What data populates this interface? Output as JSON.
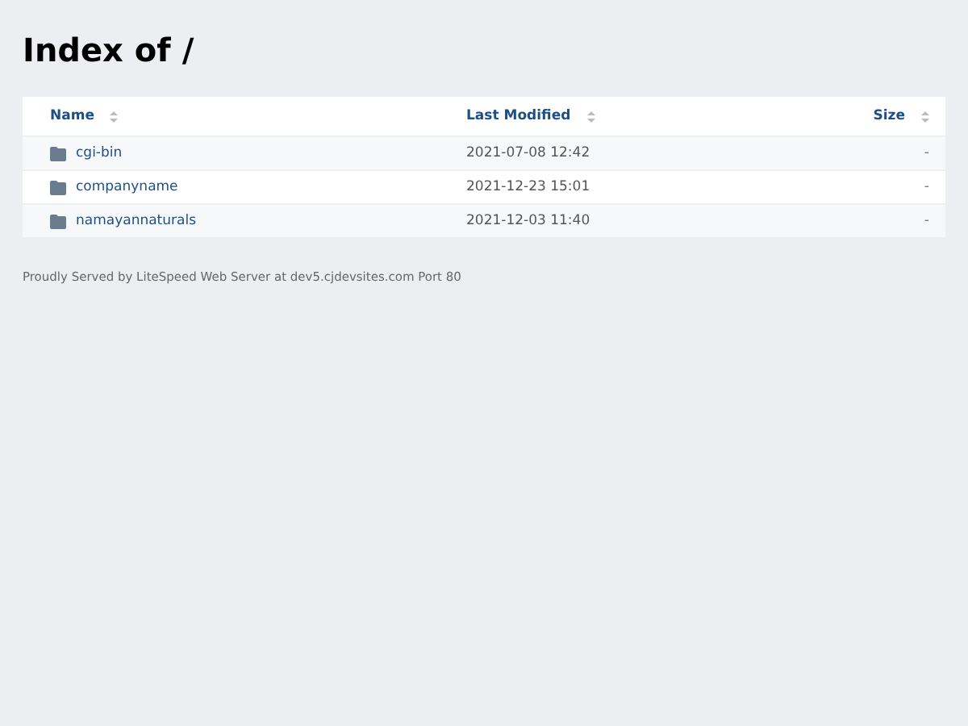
{
  "title": "Index of /",
  "table": {
    "columns": [
      {
        "label": "Name"
      },
      {
        "label": "Last Modified"
      },
      {
        "label": "Size"
      }
    ],
    "rows": [
      {
        "kind": "folder",
        "name": "cgi-bin",
        "modified": "2021-07-08 12:42",
        "size": "-"
      },
      {
        "kind": "folder",
        "name": "companyname",
        "modified": "2021-12-23 15:01",
        "size": "-"
      },
      {
        "kind": "folder",
        "name": "namayannaturals",
        "modified": "2021-12-03 11:40",
        "size": "-"
      }
    ]
  },
  "footer": "Proudly Served by LiteSpeed Web Server at dev5.cjdevsites.com Port 80"
}
